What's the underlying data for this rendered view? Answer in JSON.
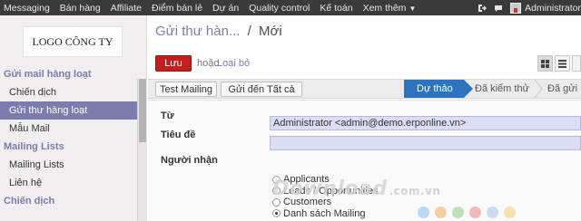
{
  "top_nav": {
    "items": [
      "Messaging",
      "Bán hàng",
      "Affiliate",
      "Điểm bán lẻ",
      "Dự án",
      "Quality control",
      "Kế toán",
      "Xem thêm"
    ],
    "user": "Administrator"
  },
  "sidebar": {
    "logo_text": "LOGO CÔNG TY",
    "sections": [
      {
        "title": "Gửi mail hàng loạt",
        "items": [
          "Chiến dịch",
          "Gửi thư hàng loạt",
          "Mẫu Mail"
        ]
      },
      {
        "title": "Mailing Lists",
        "items": [
          "Mailing Lists",
          "Liên hệ"
        ]
      },
      {
        "title": "Chiến dịch",
        "items": []
      }
    ],
    "active_item": "Gửi thư hàng loạt"
  },
  "breadcrumb": {
    "parent": "Gửi thư hàn...",
    "separator": "/",
    "current": "Mới"
  },
  "toolbar": {
    "save_label": "Lưu",
    "or_label": "hoặc",
    "discard_label": "Loại bỏ"
  },
  "statusbar": {
    "buttons": [
      "Test Mailing",
      "Gửi đến Tất cả"
    ],
    "stages": [
      "Dự thảo",
      "Đã kiểm thử",
      "Đã gửi"
    ],
    "current_stage": "Dự thảo"
  },
  "form": {
    "from_label": "Từ",
    "from_value": "Administrator <admin@demo.erponline.vn>",
    "subject_label": "Tiêu đề",
    "subject_value": "",
    "recipients_label": "Người nhận",
    "recipient_options": [
      "Applicants",
      "Leads / Opportunities",
      "Customers",
      "Danh sách Mailing"
    ],
    "recipient_selected": "Danh sách Mailing"
  },
  "watermark": {
    "text": "Download",
    "suffix": ".com.vn"
  },
  "colors": {
    "accent": "#7c7bad",
    "save": "#c21f1f",
    "stage_current": "#2d74be",
    "topbar": "#3a3a3a"
  }
}
